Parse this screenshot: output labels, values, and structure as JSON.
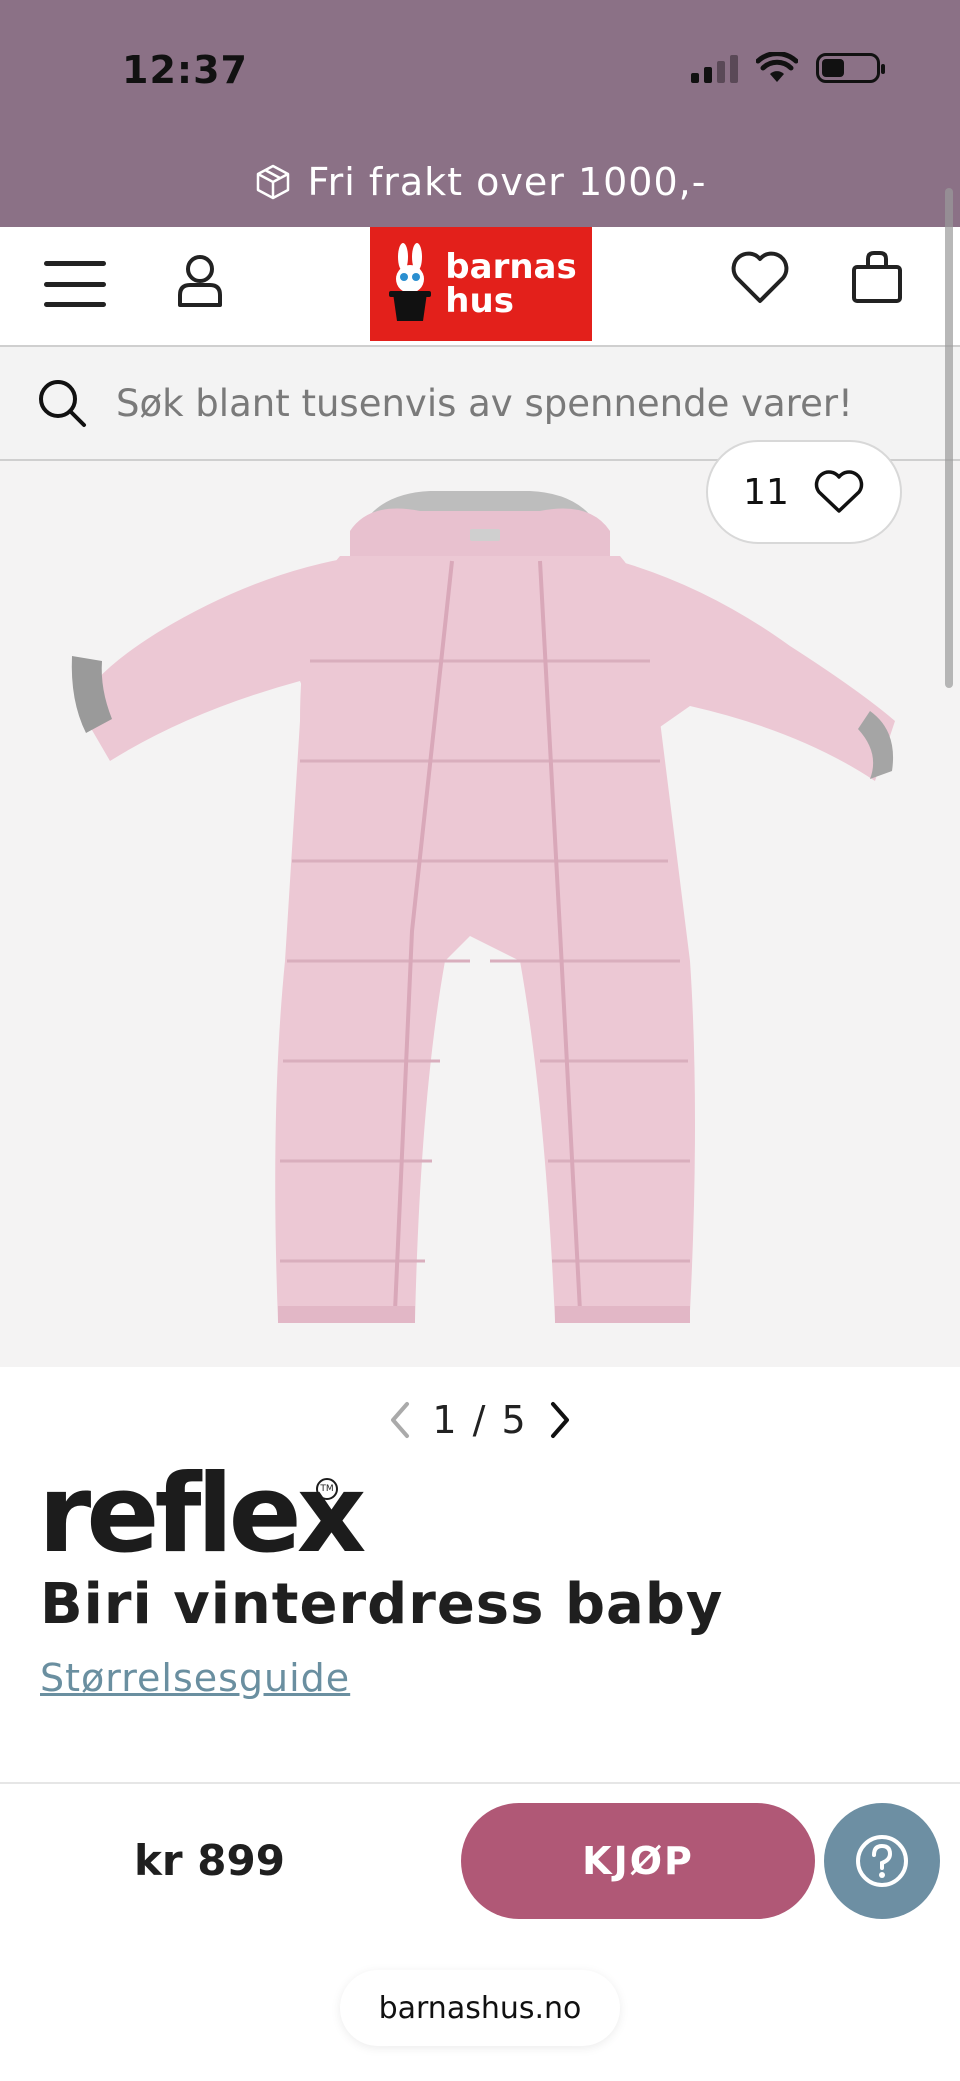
{
  "status_bar": {
    "time": "12:37"
  },
  "promo": {
    "text": "Fri frakt over 1000,-",
    "icon": "package-icon"
  },
  "header": {
    "logo_line1": "barnas",
    "logo_line2": "hus",
    "icons": [
      "menu-icon",
      "user-icon",
      "heart-icon",
      "shopping-bag-icon"
    ]
  },
  "search": {
    "placeholder": "Søk blant tusenvis av spennende varer!"
  },
  "product": {
    "favorites_count": "11",
    "pager_text": "1 / 5",
    "brand": "reflex",
    "brand_mark": "TM",
    "title": "Biri vinterdress baby",
    "size_guide": "Størrelsesguide",
    "price": "kr 899",
    "buy_label": "KJØP"
  },
  "browser": {
    "url": "barnashus.no"
  },
  "colors": {
    "top_band": "#8b7186",
    "logo_red": "#e3201b",
    "buy_button": "#b05876",
    "help_button": "#6d8fa3",
    "link": "#6a8fa0",
    "product_pink": "#ecc8d4"
  }
}
